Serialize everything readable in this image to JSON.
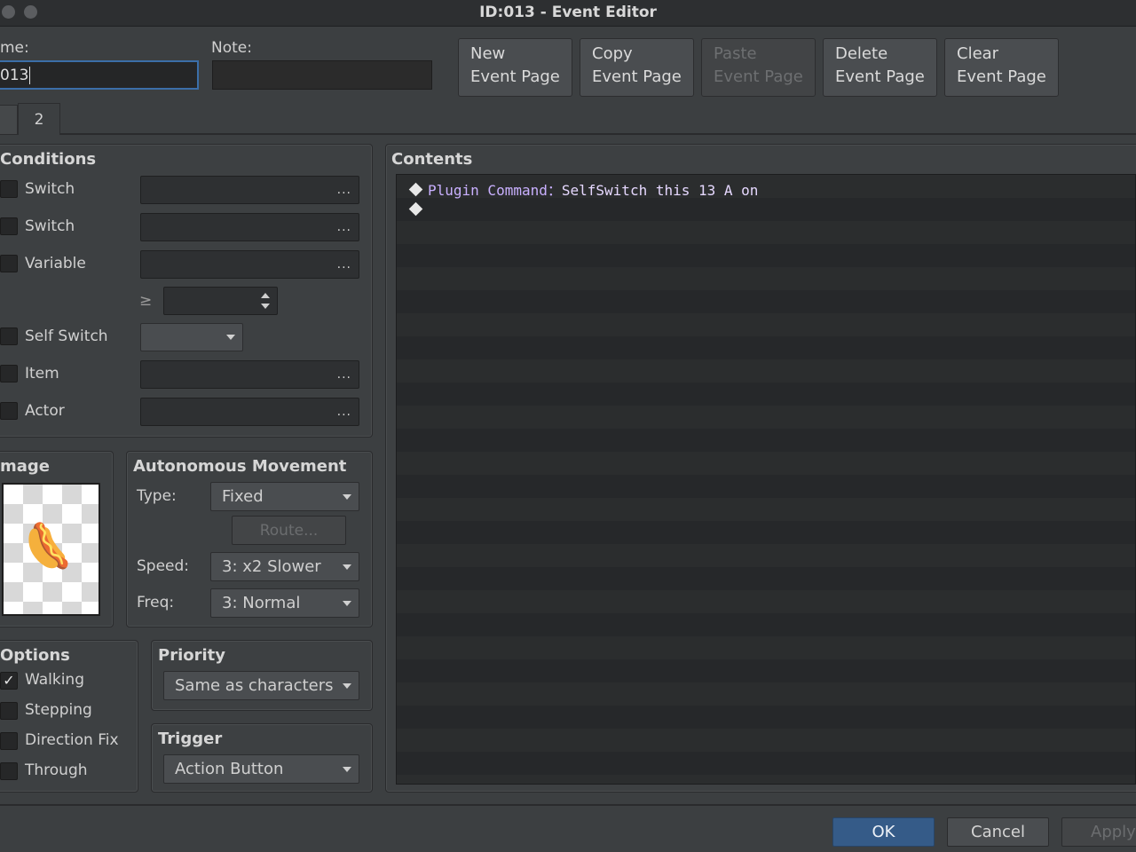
{
  "window": {
    "title": "ID:013 - Event Editor"
  },
  "header": {
    "name_label": "me:",
    "name_value": "013",
    "note_label": "Note:",
    "note_value": "",
    "buttons": [
      {
        "line1": "New",
        "line2": "Event Page",
        "enabled": true
      },
      {
        "line1": "Copy",
        "line2": "Event Page",
        "enabled": true
      },
      {
        "line1": "Paste",
        "line2": "Event Page",
        "enabled": false
      },
      {
        "line1": "Delete",
        "line2": "Event Page",
        "enabled": true
      },
      {
        "line1": "Clear",
        "line2": "Event Page",
        "enabled": true
      }
    ]
  },
  "tabs": [
    {
      "label": ""
    },
    {
      "label": "2"
    }
  ],
  "conditions": {
    "title": "Conditions",
    "switch1_label": "Switch",
    "switch2_label": "Switch",
    "variable_label": "Variable",
    "compare_symbol": "≥",
    "variable_value": "",
    "self_switch_label": "Self Switch",
    "self_switch_value": "",
    "item_label": "Item",
    "actor_label": "Actor",
    "more": "..."
  },
  "image": {
    "title": "mage",
    "emoji": "🌭"
  },
  "autonomous": {
    "title": "Autonomous Movement",
    "type_label": "Type:",
    "type_value": "Fixed",
    "route_label": "Route...",
    "speed_label": "Speed:",
    "speed_value": "3: x2 Slower",
    "freq_label": "Freq:",
    "freq_value": "3: Normal"
  },
  "options": {
    "title": "Options",
    "walking_label": "Walking",
    "walking_checked": "✓",
    "stepping_label": "Stepping",
    "direction_fix_label": "Direction Fix",
    "through_label": "Through"
  },
  "priority": {
    "title": "Priority",
    "value": "Same as characters"
  },
  "trigger": {
    "title": "Trigger",
    "value": "Action Button"
  },
  "contents": {
    "title": "Contents",
    "command_name": "Plugin Command",
    "command_sep": "：",
    "command_args": "SelfSwitch this 13 A on"
  },
  "footer": {
    "ok": "OK",
    "cancel": "Cancel",
    "apply": "Apply"
  },
  "colors": {
    "command_name": "#c9b0ff",
    "command_args": "#e6d8ff",
    "accent": "#3b6ea8"
  }
}
